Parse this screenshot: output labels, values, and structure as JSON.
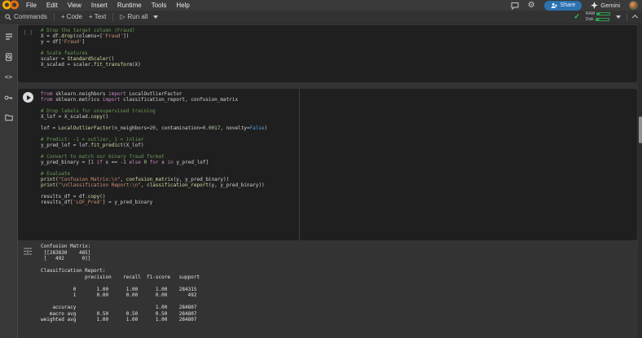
{
  "menubar": {
    "menu_items": [
      "File",
      "Edit",
      "View",
      "Insert",
      "Runtime",
      "Tools",
      "Help"
    ],
    "share_label": "Share",
    "gemini_label": "Gemini",
    "icons": [
      "colab-logo-icon",
      "comment-icon",
      "gear-icon",
      "share-person-icon",
      "gemini-sparkle-icon",
      "user-avatar"
    ]
  },
  "toolbar": {
    "commands_label": "Commands",
    "add_code_label": "+ Code",
    "add_text_label": "+ Text",
    "run_all_label": "Run all",
    "ram_label": "RAM",
    "disk_label": "Disk",
    "icons": [
      "search-icon",
      "play-icon",
      "caret-down-icon",
      "check-icon",
      "chevron-up-icon"
    ]
  },
  "sidebar": {
    "icons": [
      {
        "name": "table-of-contents-icon"
      },
      {
        "name": "find-replace-icon"
      },
      {
        "name": "code-snippets-icon"
      },
      {
        "name": "secrets-key-icon"
      },
      {
        "name": "files-folder-icon"
      }
    ]
  },
  "glyphs": {
    "play_outline": "▷",
    "check": "✓",
    "gear": "⚙",
    "code_brackets": "<>"
  },
  "notebook": {
    "cells": [
      {
        "type": "code",
        "exec_indicator": "[ ]",
        "lines": [
          [
            {
              "t": "# Drop the target column (Fraud)",
              "c": "cm"
            }
          ],
          [
            {
              "t": "X = df.",
              "c": "pl"
            },
            {
              "t": "drop",
              "c": "fn"
            },
            {
              "t": "(columns=[",
              "c": "pl"
            },
            {
              "t": "'Fraud'",
              "c": "st"
            },
            {
              "t": "])",
              "c": "pl"
            }
          ],
          [
            {
              "t": "y = df[",
              "c": "pl"
            },
            {
              "t": "'Fraud'",
              "c": "st"
            },
            {
              "t": "]",
              "c": "pl"
            }
          ],
          [],
          [
            {
              "t": "# Scale features",
              "c": "cm"
            }
          ],
          [
            {
              "t": "scaler = ",
              "c": "pl"
            },
            {
              "t": "StandardScaler",
              "c": "fn"
            },
            {
              "t": "()",
              "c": "pl"
            }
          ],
          [
            {
              "t": "X_scaled = scaler.",
              "c": "pl"
            },
            {
              "t": "fit_transform",
              "c": "fn"
            },
            {
              "t": "(X)",
              "c": "pl"
            }
          ]
        ]
      },
      {
        "type": "code",
        "has_run_button": true,
        "lines": [
          [
            {
              "t": "from",
              "c": "kw"
            },
            {
              "t": " sklearn.neighbors ",
              "c": "pl"
            },
            {
              "t": "import",
              "c": "kw"
            },
            {
              "t": " LocalOutlierFactor",
              "c": "pl"
            }
          ],
          [
            {
              "t": "from",
              "c": "kw"
            },
            {
              "t": " sklearn.metrics ",
              "c": "pl"
            },
            {
              "t": "import",
              "c": "kw"
            },
            {
              "t": " classification_report, confusion_matrix",
              "c": "pl"
            }
          ],
          [],
          [
            {
              "t": "# Drop labels for unsupervised training",
              "c": "cm"
            }
          ],
          [
            {
              "t": "X_lof = X_scaled.",
              "c": "pl"
            },
            {
              "t": "copy",
              "c": "fn"
            },
            {
              "t": "()",
              "c": "pl"
            }
          ],
          [],
          [
            {
              "t": "lof = ",
              "c": "pl"
            },
            {
              "t": "LocalOutlierFactor",
              "c": "fn"
            },
            {
              "t": "(n_neighbors=",
              "c": "pl"
            },
            {
              "t": "20",
              "c": "nu"
            },
            {
              "t": ", contamination=",
              "c": "pl"
            },
            {
              "t": "0.0017",
              "c": "nu"
            },
            {
              "t": ", novelty=",
              "c": "pl"
            },
            {
              "t": "False",
              "c": "bo"
            },
            {
              "t": ")",
              "c": "pl"
            }
          ],
          [],
          [
            {
              "t": "# Predict: -1 = outlier, 1 = inlier",
              "c": "cm"
            }
          ],
          [
            {
              "t": "y_pred_lof = lof.",
              "c": "pl"
            },
            {
              "t": "fit_predict",
              "c": "fn"
            },
            {
              "t": "(X_lof)",
              "c": "pl"
            }
          ],
          [],
          [
            {
              "t": "# Convert to match our binary fraud format",
              "c": "cm"
            }
          ],
          [
            {
              "t": "y_pred_binary = [",
              "c": "pl"
            },
            {
              "t": "1",
              "c": "nu"
            },
            {
              "t": " ",
              "c": "pl"
            },
            {
              "t": "if",
              "c": "kw"
            },
            {
              "t": " x == -",
              "c": "pl"
            },
            {
              "t": "1",
              "c": "nu"
            },
            {
              "t": " ",
              "c": "pl"
            },
            {
              "t": "else",
              "c": "kw"
            },
            {
              "t": " ",
              "c": "pl"
            },
            {
              "t": "0",
              "c": "nu"
            },
            {
              "t": " ",
              "c": "pl"
            },
            {
              "t": "for",
              "c": "kw"
            },
            {
              "t": " x ",
              "c": "pl"
            },
            {
              "t": "in",
              "c": "kw"
            },
            {
              "t": " y_pred_lof]",
              "c": "pl"
            }
          ],
          [],
          [
            {
              "t": "# Evaluate",
              "c": "cm"
            }
          ],
          [
            {
              "t": "print",
              "c": "fn"
            },
            {
              "t": "(",
              "c": "pl"
            },
            {
              "t": "\"Confusion Matrix:\\n\"",
              "c": "st"
            },
            {
              "t": ", ",
              "c": "pl"
            },
            {
              "t": "confusion_matrix",
              "c": "fn"
            },
            {
              "t": "(y, y_pred_binary))",
              "c": "pl"
            }
          ],
          [
            {
              "t": "print",
              "c": "fn"
            },
            {
              "t": "(",
              "c": "pl"
            },
            {
              "t": "\"\\nClassification Report:\\n\"",
              "c": "st"
            },
            {
              "t": ", ",
              "c": "pl"
            },
            {
              "t": "classification_report",
              "c": "fn"
            },
            {
              "t": "(y, y_pred_binary))",
              "c": "pl"
            }
          ],
          [],
          [
            {
              "t": "results_df = df.",
              "c": "pl"
            },
            {
              "t": "copy",
              "c": "fn"
            },
            {
              "t": "()",
              "c": "pl"
            }
          ],
          [
            {
              "t": "results_df[",
              "c": "pl"
            },
            {
              "t": "'LOF_Pred'",
              "c": "st"
            },
            {
              "t": "] = y_pred_binary",
              "c": "pl"
            }
          ]
        ]
      }
    ],
    "output": {
      "text": "Confusion Matrix:\n [[283830    485]\n [   492      0]]\n\nClassification Report:\n               precision    recall  f1-score   support\n\n           0       1.00      1.00      1.00    284315\n           1       0.00      0.00      0.00       492\n\n    accuracy                           1.00    284807\n   macro avg       0.50      0.50      0.50    284807\nweighted avg       1.00      1.00      1.00    284807"
    }
  },
  "colors": {
    "share_blue": "#2b72b0",
    "check_green": "#41c352",
    "meter_green": "#2e9e4f",
    "logo_orange_left": "#f9ab00",
    "logo_orange_right": "#e8710a",
    "syntax_comment": "#6a9955",
    "syntax_keyword": "#c586c0",
    "syntax_string": "#ce9178",
    "syntax_function": "#dcdcaa",
    "syntax_number": "#b5cea8",
    "syntax_constant": "#569cd6",
    "code_text": "#d4d4d4"
  }
}
